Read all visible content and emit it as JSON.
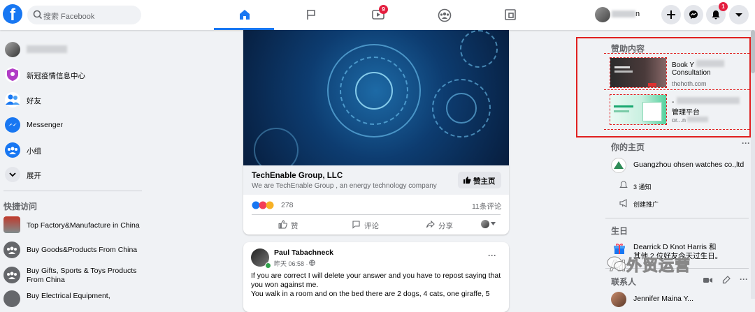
{
  "topbar": {
    "logo": "f",
    "search_placeholder": "搜索 Facebook",
    "video_badge": "9",
    "notification_badge": "1",
    "profile_name": "n"
  },
  "left": {
    "profile_name": "",
    "items": [
      {
        "label": "新冠疫情信息中心",
        "icon": "covid-shield-icon"
      },
      {
        "label": "好友",
        "icon": "friends-icon"
      },
      {
        "label": "Messenger",
        "icon": "messenger-icon"
      },
      {
        "label": "小组",
        "icon": "groups-icon"
      },
      {
        "label": "展开",
        "icon": "chevron-down-icon"
      }
    ],
    "quick_title": "快捷访问",
    "quick_items": [
      {
        "label": "Top Factory&Manufacture in China"
      },
      {
        "label": "Buy Goods&Products From China"
      },
      {
        "label": "Buy Gifts, Sports & Toys Products From China"
      },
      {
        "label": "Buy Electrical Equipment,"
      }
    ]
  },
  "feed": {
    "ad": {
      "page_name": "TechEnable Group, LLC",
      "description": "We are TechEnable Group , an energy technology company",
      "like_page_label": "赞主页",
      "reaction_count": "278",
      "comment_count": "11条评论",
      "like_label": "赞",
      "comment_label": "评论",
      "share_label": "分享"
    },
    "post": {
      "author": "Paul Tabachneck",
      "time": "昨天 06:58 ·",
      "more": "···",
      "text_lines": [
        "If you are correct I will delete your answer and you have to repost saying that",
        "you won against me.",
        "You walk in a room and on the bed there are 2 dogs, 4 cats, one giraffe, 5"
      ]
    }
  },
  "right": {
    "sponsored_title": "赞助内容",
    "ads": [
      {
        "title_line1": "Book Y",
        "title_line2": "Consultation",
        "domain": "thehoth.com"
      },
      {
        "title_line1": "-",
        "title_line2": "管理平台",
        "domain": "or...n"
      }
    ],
    "pages_title": "你的主页",
    "pages_more": "···",
    "page_name": "Guangzhou ohsen watches co.,ltd",
    "notifications": "3 通知",
    "create_promo": "创建推广",
    "birthdays_title": "生日",
    "birthday_line1": "Dearrick D Knot Harris 和",
    "birthday_line2": "其他 2 位好友今天过生日。",
    "contacts_title": "联系人",
    "contact_name": "Jennifer Maina Y..."
  },
  "watermark": "AI外贸运营",
  "colors": {
    "brand": "#1877f2",
    "badge": "#e41e3f",
    "annotation": "#e02020"
  }
}
